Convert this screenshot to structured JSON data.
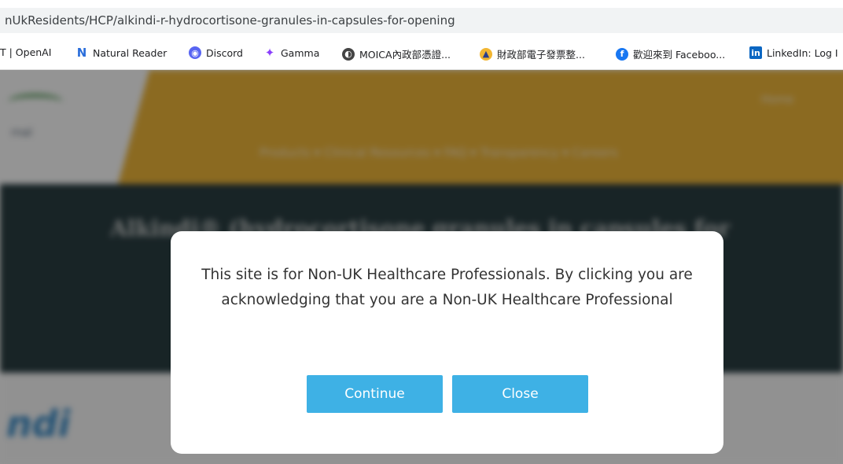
{
  "browser": {
    "url": "nUkResidents/HCP/alkindi-r-hydrocortisone-granules-in-capsules-for-opening",
    "bookmarks": [
      {
        "label": "T | OpenAI",
        "icon": "none"
      },
      {
        "label": "Natural Reader",
        "icon": "natural-reader-icon",
        "color": "#2a6edb"
      },
      {
        "label": "Discord",
        "icon": "discord-icon",
        "color": "#5865f2"
      },
      {
        "label": "Gamma",
        "icon": "gamma-icon",
        "color": "#8a3ffc"
      },
      {
        "label": "MOICA內政部憑證...",
        "icon": "globe-icon",
        "color": "#444444"
      },
      {
        "label": "財政部電子發票整...",
        "icon": "ministry-icon",
        "color": "#f2b632"
      },
      {
        "label": "歡迎來到 Faceboo...",
        "icon": "facebook-icon",
        "color": "#1877f2"
      },
      {
        "label": "LinkedIn: Log I",
        "icon": "linkedin-icon",
        "color": "#0a66c2"
      }
    ]
  },
  "site": {
    "home": "Home",
    "nav": "Products ▾   Clinical Resources ▾   FAQ ▾   Transparency ▾   Careers",
    "hero_title": "Alkindi® (hydrocortisone granules in capsules for",
    "brand": "ndi"
  },
  "modal": {
    "message": "This site is for Non-UK Healthcare Professionals. By clicking you are acknowledging that you are a Non-UK Healthcare Professional",
    "continue_label": "Continue",
    "close_label": "Close",
    "button_color": "#3eb1e5"
  }
}
